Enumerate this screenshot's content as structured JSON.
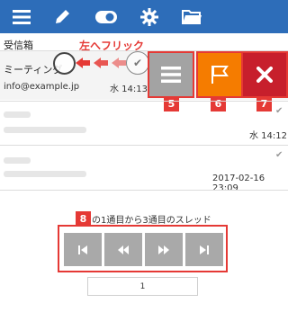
{
  "toolbar": {
    "icons": [
      "menu-icon",
      "compose-icon",
      "toggle-icon",
      "settings-icon",
      "folder-icon"
    ],
    "color": "#2d6db9"
  },
  "folder": {
    "title": "受信箱"
  },
  "annotation": {
    "swipe_label": "左へフリック"
  },
  "messages": [
    {
      "subject": "ミーティング",
      "from": "info@example.jp",
      "time": "水 14:13"
    },
    {
      "subject": "",
      "from": "",
      "time": "水 14:12"
    },
    {
      "subject": "",
      "from": "",
      "time": "2017-02-16 23:09"
    }
  ],
  "actions": {
    "menu": {
      "icon": "menu-icon",
      "number": "5",
      "color": "#a3a3a3"
    },
    "flag": {
      "icon": "flag-icon",
      "number": "6",
      "color": "#f57c00"
    },
    "delete": {
      "icon": "close-icon",
      "number": "7",
      "color": "#c71f2c"
    }
  },
  "paging": {
    "number": "8",
    "label": "の1通目から3通目のスレッド",
    "buttons": [
      "first-page-icon",
      "previous-page-icon",
      "next-page-icon",
      "last-page-icon"
    ],
    "current_page": "1"
  },
  "accent": "#e53935"
}
